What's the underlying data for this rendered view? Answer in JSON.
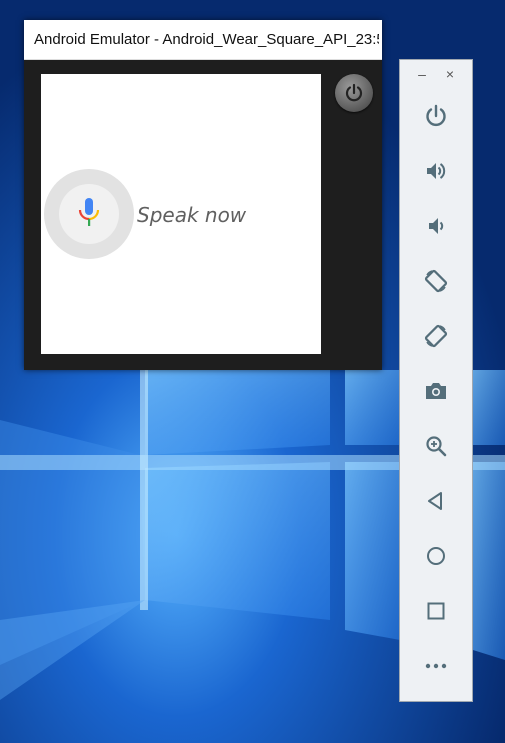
{
  "window": {
    "title": "Android Emulator - Android_Wear_Square_API_23:5..."
  },
  "watch": {
    "prompt": "Speak now",
    "mic_colors": [
      "#4285F4",
      "#EA4335",
      "#FBBC05",
      "#34A853"
    ]
  },
  "toolbar": {
    "minimize": "–",
    "close": "×",
    "icon_color": "#546e7a",
    "buttons": [
      {
        "name": "power-icon"
      },
      {
        "name": "volume-up-icon"
      },
      {
        "name": "volume-down-icon"
      },
      {
        "name": "rotate-left-icon"
      },
      {
        "name": "rotate-right-icon"
      },
      {
        "name": "camera-icon"
      },
      {
        "name": "zoom-icon"
      },
      {
        "name": "back-icon"
      },
      {
        "name": "home-icon"
      },
      {
        "name": "overview-icon"
      },
      {
        "name": "more-icon"
      }
    ]
  }
}
